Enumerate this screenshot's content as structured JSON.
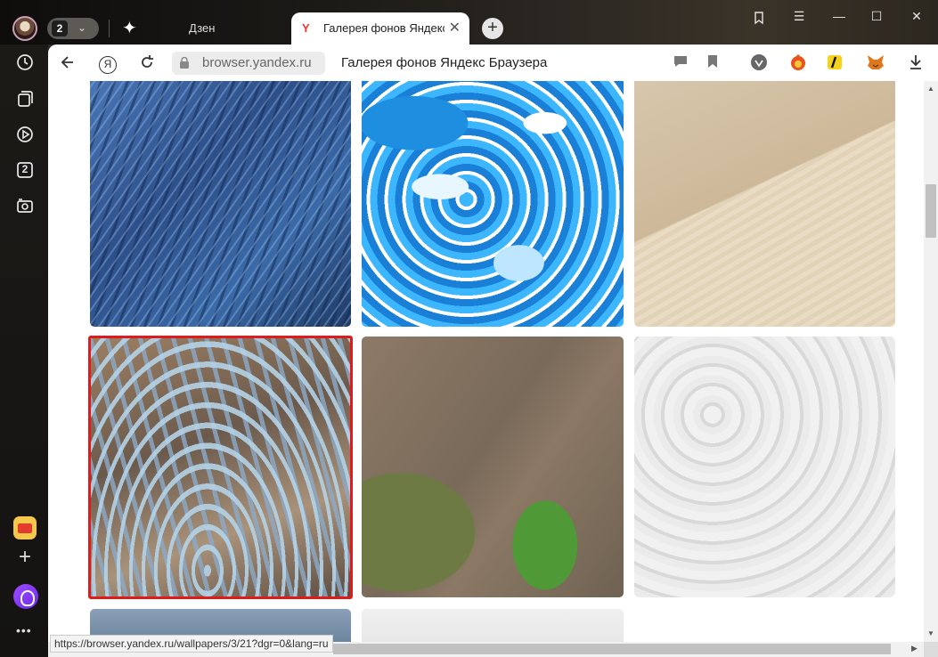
{
  "tabs": {
    "count": "2",
    "inactive_tab_label": "Дзен",
    "active_tab_title": "Галерея фонов Яндекс Браузера",
    "active_tab_favicon": "Y"
  },
  "toolbar": {
    "url_host": "browser.yandex.ru",
    "page_title": "Галерея фонов Яндекс Браузера",
    "yandex_button": "Я"
  },
  "sidebar": {
    "tab_badge": "2",
    "more": "•••"
  },
  "status": {
    "hover_url": "https://browser.yandex.ru/wallpapers/3/21?dgr=0&lang=ru"
  },
  "gallery": {
    "selected_index": 3,
    "selected_border_color": "#e01b1b",
    "tiles": [
      {
        "name": "blue-feathers"
      },
      {
        "name": "blue-marble-fluid"
      },
      {
        "name": "sand-dune"
      },
      {
        "name": "glacial-river-delta"
      },
      {
        "name": "river-delta-aerial"
      },
      {
        "name": "white-snow-texture"
      },
      {
        "name": "blue-landscape"
      },
      {
        "name": "white-snow-field"
      }
    ]
  },
  "colors": {
    "accent": "#6a28f0",
    "frame_dark": "#1c1a17"
  }
}
